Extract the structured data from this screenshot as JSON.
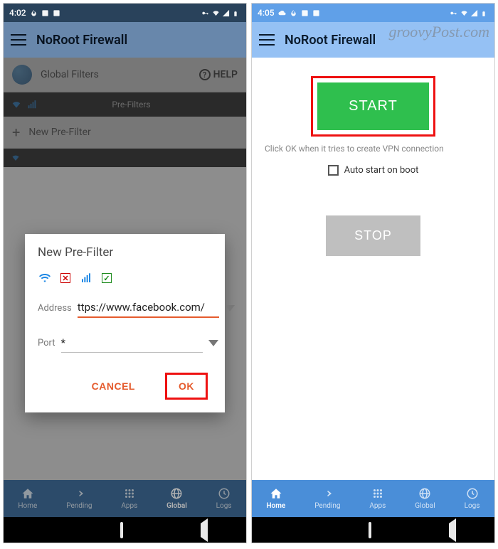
{
  "watermark": "groovyPost.com",
  "left": {
    "status": {
      "time": "4:02"
    },
    "appbar": {
      "title": "NoRoot Firewall"
    },
    "globalFilters": {
      "label": "Global Filters",
      "help": "HELP"
    },
    "tabs": {
      "preFilters": "Pre-Filters"
    },
    "newFilter": {
      "label": "New Pre-Filter"
    },
    "dialog": {
      "title": "New Pre-Filter",
      "addressLabel": "Address",
      "addressValue": "ttps://www.facebook.com/",
      "portLabel": "Port",
      "portValue": "*",
      "cancel": "CANCEL",
      "ok": "OK"
    },
    "bottomnav": {
      "home": "Home",
      "pending": "Pending",
      "apps": "Apps",
      "global": "Global",
      "logs": "Logs"
    }
  },
  "right": {
    "status": {
      "time": "4:05"
    },
    "appbar": {
      "title": "NoRoot Firewall"
    },
    "start": "START",
    "hint": "Click OK when it tries to create VPN connection",
    "autostart": "Auto start on boot",
    "stop": "STOP",
    "bottomnav": {
      "home": "Home",
      "pending": "Pending",
      "apps": "Apps",
      "global": "Global",
      "logs": "Logs"
    }
  }
}
